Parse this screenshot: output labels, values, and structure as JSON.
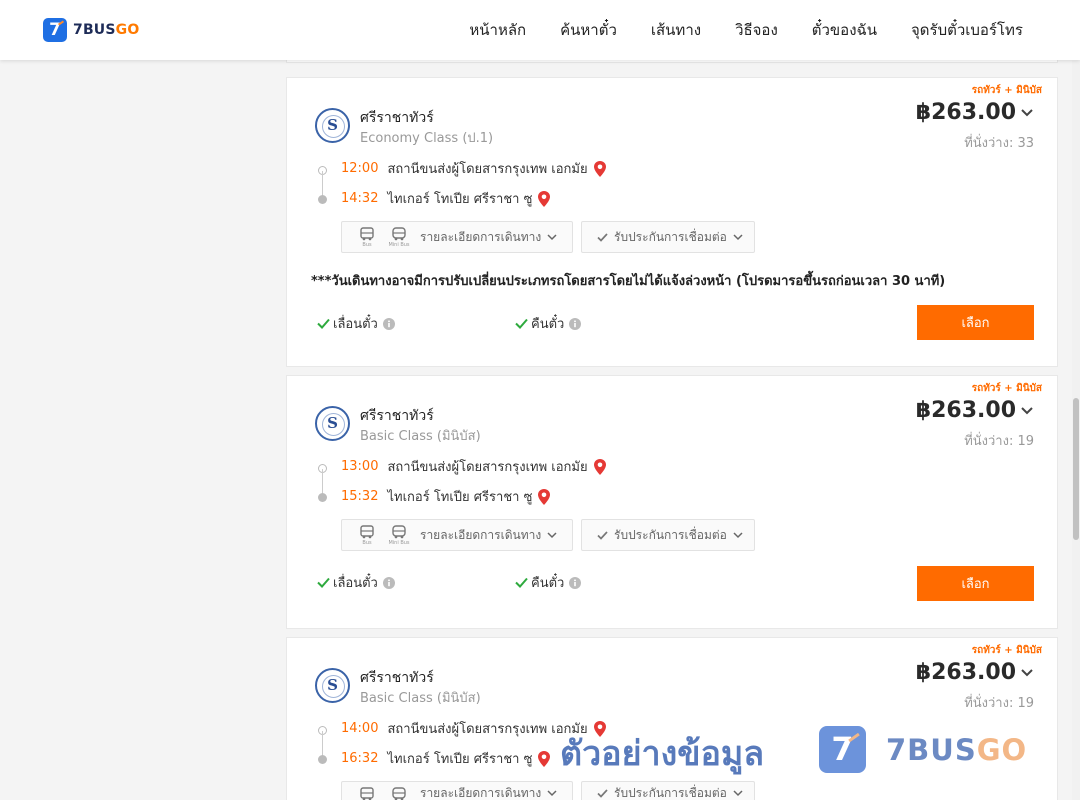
{
  "header": {
    "logo_digit": "7",
    "logo_text_1": "7BUS",
    "logo_text_2": "GO",
    "nav": [
      "หน้าหลัก",
      "ค้นหาตั๋ว",
      "เส้นทาง",
      "วิธีจอง",
      "ตั๋วของฉัน",
      "จุดรับตั๋วเบอร์โทร"
    ]
  },
  "colors": {
    "accent": "#ff6b00",
    "brand_blue": "#1f6fe3",
    "check_green": "#2eaa3e",
    "pin_red": "#e53935"
  },
  "cards": [
    {
      "tag": "รถทัวร์ + มินิบัส",
      "operator_mark": "S",
      "operator": "ศรีราชาทัวร์",
      "class": "Economy Class (ป.1)",
      "price": "฿263.00",
      "seats": "ที่นั่งว่าง: 33",
      "dep_time": "12:00",
      "dep_station": "สถานีขนส่งผู้โดยสารกรุงเทพ เอกมัย",
      "arr_time": "14:32",
      "arr_station": "ไทเกอร์ โทเปีย ศรีราชา ซู",
      "vehicle_1": "Bus",
      "vehicle_2": "Mini Bus",
      "details_label": "รายละเอียดการเดินทาง",
      "insurance_label": "รับประกันการเชื่อมต่อ",
      "notice": "***วันเดินทางอาจมีการปรับเปลี่ยนประเภทรถโดยสารโดยไม่ได้แจ้งล่วงหน้า (โปรดมารอขึ้นรถก่อนเวลา 30 นาที)",
      "feature_1": "เลื่อนตั๋ว",
      "feature_2": "คืนตั๋ว",
      "select_label": "เลือก"
    },
    {
      "tag": "รถทัวร์ + มินิบัส",
      "operator_mark": "S",
      "operator": "ศรีราชาทัวร์",
      "class": "Basic Class (มินิบัส)",
      "price": "฿263.00",
      "seats": "ที่นั่งว่าง: 19",
      "dep_time": "13:00",
      "dep_station": "สถานีขนส่งผู้โดยสารกรุงเทพ เอกมัย",
      "arr_time": "15:32",
      "arr_station": "ไทเกอร์ โทเปีย ศรีราชา ซู",
      "vehicle_1": "Bus",
      "vehicle_2": "Mini Bus",
      "details_label": "รายละเอียดการเดินทาง",
      "insurance_label": "รับประกันการเชื่อมต่อ",
      "feature_1": "เลื่อนตั๋ว",
      "feature_2": "คืนตั๋ว",
      "select_label": "เลือก"
    },
    {
      "tag": "รถทัวร์ + มินิบัส",
      "operator_mark": "S",
      "operator": "ศรีราชาทัวร์",
      "class": "Basic Class (มินิบัส)",
      "price": "฿263.00",
      "seats": "ที่นั่งว่าง: 19",
      "dep_time": "14:00",
      "dep_station": "สถานีขนส่งผู้โดยสารกรุงเทพ เอกมัย",
      "arr_time": "16:32",
      "arr_station": "ไทเกอร์ โทเปีย ศรีราชา ซู",
      "vehicle_1": "Bus",
      "vehicle_2": "Mini Bus",
      "details_label": "รายละเอียดการเดินทาง",
      "insurance_label": "รับประกันการเชื่อมต่อ"
    }
  ],
  "watermark": {
    "text": "ตัวอย่างข้อมูล",
    "logo_digit": "7",
    "brand_1": "7BUS",
    "brand_2": "GO"
  }
}
